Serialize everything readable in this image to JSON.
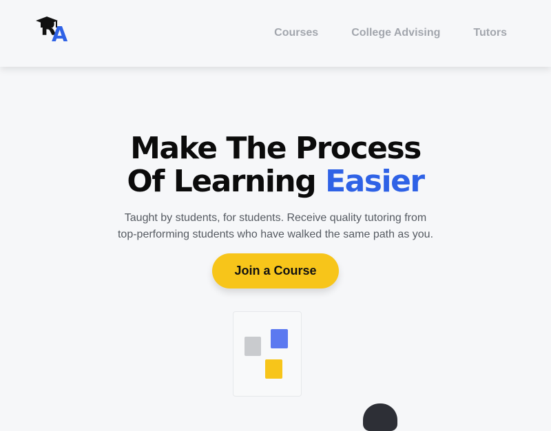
{
  "header": {
    "logo": {
      "letter_r": "R",
      "letter_a": "A",
      "icon": "graduation-cap-icon"
    },
    "nav": [
      {
        "label": "Courses"
      },
      {
        "label": "College Advising"
      },
      {
        "label": "Tutors"
      }
    ]
  },
  "hero": {
    "title_line1": "Make The Process",
    "title_line2_prefix": "Of Learning ",
    "title_line2_accent": "Easier",
    "subtitle_line1": "Taught by students, for students. Receive quality tutoring from",
    "subtitle_line2": "top-performing students who have walked the same path as you.",
    "cta_label": "Join a Course"
  },
  "colors": {
    "accent_blue": "#2f62e6",
    "cta_yellow": "#f7c51a",
    "nav_gray": "#a2a6ad",
    "background": "#f6f7f9"
  }
}
